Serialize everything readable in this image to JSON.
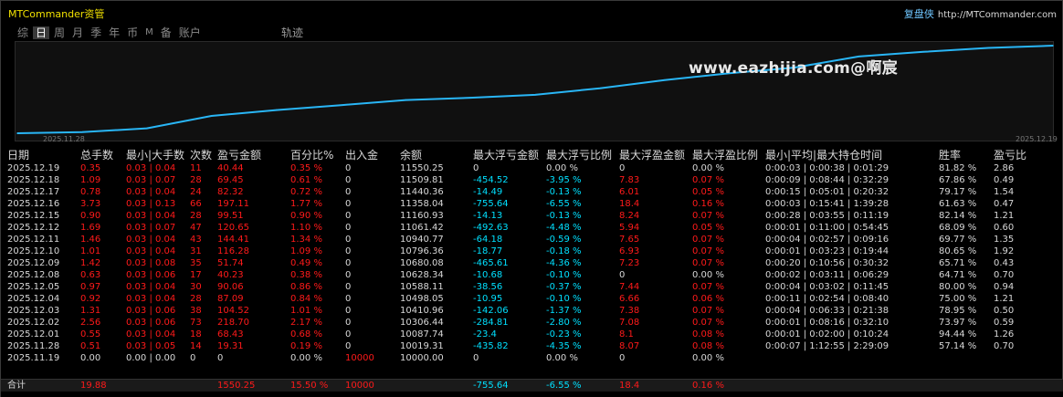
{
  "app": {
    "title": "MTCommander资管",
    "brand": "复盘侠",
    "url": "http://MTCommander.com"
  },
  "tabs": [
    {
      "label": "综",
      "active": false
    },
    {
      "label": "日",
      "active": true
    },
    {
      "label": "周",
      "active": false
    },
    {
      "label": "月",
      "active": false
    },
    {
      "label": "季",
      "active": false
    },
    {
      "label": "年",
      "active": false
    },
    {
      "label": "币",
      "active": false
    },
    {
      "label": "M",
      "active": false
    },
    {
      "label": "备",
      "active": false
    },
    {
      "label": "账户",
      "active": false
    }
  ],
  "track_label": "轨迹",
  "chart": {
    "watermark": "www.eazhijia.com@啊宸",
    "x_start": "2025.11.28",
    "x_end": "2025.12.19",
    "line_color": "#29b6f6"
  },
  "chart_data": {
    "type": "line",
    "x": [
      "2025.11.19",
      "2025.11.28",
      "2025.12.01",
      "2025.12.02",
      "2025.12.03",
      "2025.12.04",
      "2025.12.05",
      "2025.12.08",
      "2025.12.09",
      "2025.12.10",
      "2025.12.11",
      "2025.12.12",
      "2025.12.15",
      "2025.12.16",
      "2025.12.17",
      "2025.12.18",
      "2025.12.19"
    ],
    "series": [
      {
        "values": [
          10000.0,
          10019.31,
          10087.74,
          10306.44,
          10410.96,
          10498.05,
          10588.11,
          10628.34,
          10680.08,
          10796.36,
          10940.77,
          11061.42,
          11160.93,
          11358.04,
          11440.36,
          11509.81,
          11550.25
        ]
      }
    ],
    "xlabel": "",
    "ylabel": "",
    "grid": false
  },
  "columns": [
    "日期",
    "总手数",
    "最小|大手数",
    "次数",
    "盈亏金额",
    "百分比%",
    "出入金",
    "余额",
    "最大浮亏金额",
    "最大浮亏比例",
    "最大浮盈金额",
    "最大浮盈比例",
    "最小|平均|最大持仓时间",
    "胜率",
    "盈亏比"
  ],
  "rows": [
    [
      "2025.12.19",
      "0.35",
      "0.03 | 0.04",
      "11",
      "40.44",
      "0.35 %",
      "0",
      "11550.25",
      "0",
      "0.00 %",
      "0",
      "0.00 %",
      "0:00:03 | 0:00:38 | 0:01:29",
      "81.82 %",
      "2.86"
    ],
    [
      "2025.12.18",
      "1.09",
      "0.03 | 0.07",
      "28",
      "69.45",
      "0.61 %",
      "0",
      "11509.81",
      "-454.52",
      "-3.95 %",
      "7.83",
      "0.07 %",
      "0:00:09 | 0:08:44 | 0:32:29",
      "67.86 %",
      "0.49"
    ],
    [
      "2025.12.17",
      "0.78",
      "0.03 | 0.04",
      "24",
      "82.32",
      "0.72 %",
      "0",
      "11440.36",
      "-14.49",
      "-0.13 %",
      "6.01",
      "0.05 %",
      "0:00:15 | 0:05:01 | 0:20:32",
      "79.17 %",
      "1.54"
    ],
    [
      "2025.12.16",
      "3.73",
      "0.03 | 0.13",
      "66",
      "197.11",
      "1.77 %",
      "0",
      "11358.04",
      "-755.64",
      "-6.55 %",
      "18.4",
      "0.16 %",
      "0:00:03 | 0:15:41 | 1:39:28",
      "61.63 %",
      "0.47"
    ],
    [
      "2025.12.15",
      "0.90",
      "0.03 | 0.04",
      "28",
      "99.51",
      "0.90 %",
      "0",
      "11160.93",
      "-14.13",
      "-0.13 %",
      "8.24",
      "0.07 %",
      "0:00:28 | 0:03:55 | 0:11:19",
      "82.14 %",
      "1.21"
    ],
    [
      "2025.12.12",
      "1.69",
      "0.03 | 0.07",
      "47",
      "120.65",
      "1.10 %",
      "0",
      "11061.42",
      "-492.63",
      "-4.48 %",
      "5.94",
      "0.05 %",
      "0:00:01 | 0:11:00 | 0:54:45",
      "68.09 %",
      "0.60"
    ],
    [
      "2025.12.11",
      "1.46",
      "0.03 | 0.04",
      "43",
      "144.41",
      "1.34 %",
      "0",
      "10940.77",
      "-64.18",
      "-0.59 %",
      "7.65",
      "0.07 %",
      "0:00:04 | 0:02:57 | 0:09:16",
      "69.77 %",
      "1.35"
    ],
    [
      "2025.12.10",
      "1.01",
      "0.03 | 0.04",
      "31",
      "116.28",
      "1.09 %",
      "0",
      "10796.36",
      "-18.77",
      "-0.18 %",
      "6.93",
      "0.07 %",
      "0:00:01 | 0:03:23 | 0:19:44",
      "80.65 %",
      "1.92"
    ],
    [
      "2025.12.09",
      "1.42",
      "0.03 | 0.08",
      "35",
      "51.74",
      "0.49 %",
      "0",
      "10680.08",
      "-465.61",
      "-4.36 %",
      "7.23",
      "0.07 %",
      "0:00:20 | 0:10:56 | 0:30:32",
      "65.71 %",
      "0.43"
    ],
    [
      "2025.12.08",
      "0.63",
      "0.03 | 0.06",
      "17",
      "40.23",
      "0.38 %",
      "0",
      "10628.34",
      "-10.68",
      "-0.10 %",
      "0",
      "0.00 %",
      "0:00:02 | 0:03:11 | 0:06:29",
      "64.71 %",
      "0.70"
    ],
    [
      "2025.12.05",
      "0.97",
      "0.03 | 0.04",
      "30",
      "90.06",
      "0.86 %",
      "0",
      "10588.11",
      "-38.56",
      "-0.37 %",
      "7.44",
      "0.07 %",
      "0:00:04 | 0:03:02 | 0:11:45",
      "80.00 %",
      "0.94"
    ],
    [
      "2025.12.04",
      "0.92",
      "0.03 | 0.04",
      "28",
      "87.09",
      "0.84 %",
      "0",
      "10498.05",
      "-10.95",
      "-0.10 %",
      "6.66",
      "0.06 %",
      "0:00:11 | 0:02:54 | 0:08:40",
      "75.00 %",
      "1.21"
    ],
    [
      "2025.12.03",
      "1.31",
      "0.03 | 0.06",
      "38",
      "104.52",
      "1.01 %",
      "0",
      "10410.96",
      "-142.06",
      "-1.37 %",
      "7.38",
      "0.07 %",
      "0:00:04 | 0:06:33 | 0:21:38",
      "78.95 %",
      "0.50"
    ],
    [
      "2025.12.02",
      "2.56",
      "0.03 | 0.06",
      "73",
      "218.70",
      "2.17 %",
      "0",
      "10306.44",
      "-284.81",
      "-2.80 %",
      "7.08",
      "0.07 %",
      "0:00:01 | 0:08:16 | 0:32:10",
      "73.97 %",
      "0.59"
    ],
    [
      "2025.12.01",
      "0.55",
      "0.03 | 0.04",
      "18",
      "68.43",
      "0.68 %",
      "0",
      "10087.74",
      "-23.4",
      "-0.23 %",
      "8.1",
      "0.08 %",
      "0:00:01 | 0:02:00 | 0:10:24",
      "94.44 %",
      "1.26"
    ],
    [
      "2025.11.28",
      "0.51",
      "0.03 | 0.05",
      "14",
      "19.31",
      "0.19 %",
      "0",
      "10019.31",
      "-435.82",
      "-4.35 %",
      "8.07",
      "0.08 %",
      "0:00:07 | 1:12:55 | 2:29:09",
      "57.14 %",
      "0.70"
    ],
    [
      "2025.11.19",
      "0.00",
      "0.00 | 0.00",
      "0",
      "0",
      "0.00 %",
      "10000",
      "10000.00",
      "0",
      "0.00 %",
      "0",
      "0.00 %",
      "",
      "",
      ""
    ]
  ],
  "total": [
    "合计",
    "19.88",
    "",
    "",
    "1550.25",
    "15.50 %",
    "10000",
    "",
    "-755.64",
    "-6.55 %",
    "18.4",
    "0.16 %",
    "",
    "",
    ""
  ],
  "colors": {
    "profit": "#ff1a1a",
    "drawdown": "#00e0ff",
    "title": "#f0e000",
    "brand": "#6fc6ff"
  }
}
